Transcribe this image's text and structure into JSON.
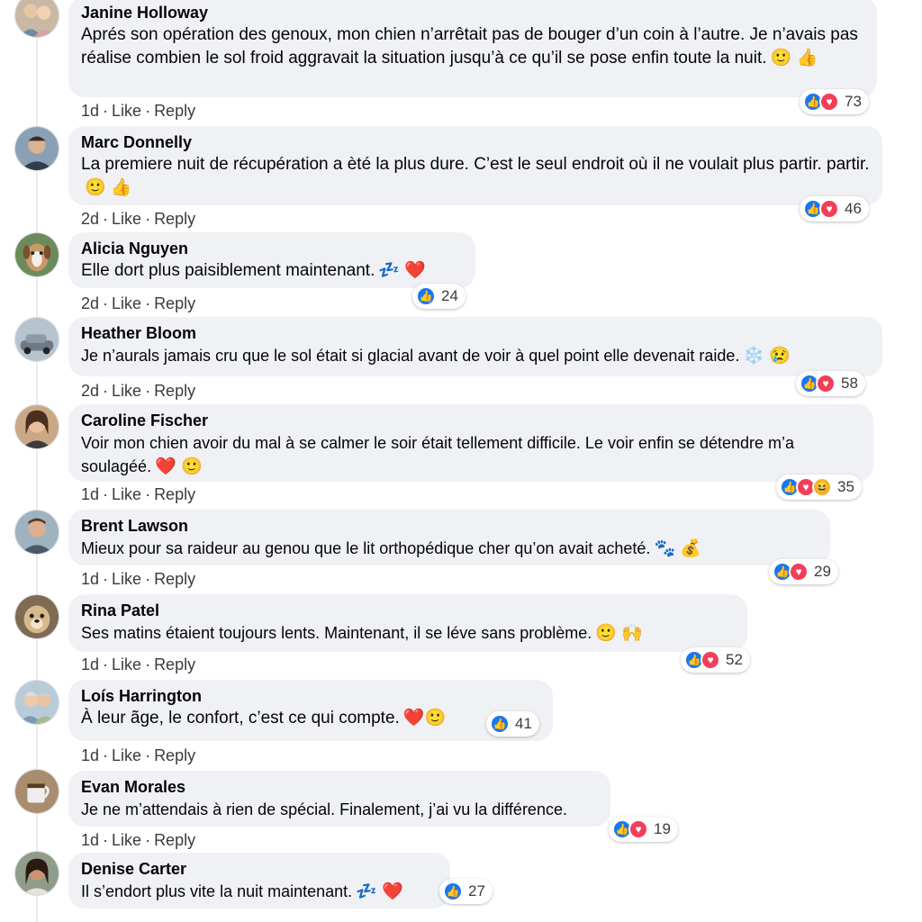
{
  "comments": [
    {
      "author": "Janine Holloway",
      "text": "Aprés son opération des genoux, mon chien n’arrêtait pas de bouger d’un coin à l’autre. Je n’avais pas réalise combien le sol froid aggravait la situation jusqu’à ce qu’il se pose enfin toute la nuit.",
      "emojis": "🙂 👍",
      "time": "1d",
      "like": "Like",
      "reply": "Reply",
      "reactions": [
        "like",
        "love"
      ],
      "count": "73"
    },
    {
      "author": "Marc Donnelly",
      "text": "La premiere nuit de récupération a èté la plus dure. C’est le seul endroit où il ne voulait plus partir. partir.",
      "emojis": "🙂 👍",
      "time": "2d",
      "like": "Like",
      "reply": "Reply",
      "reactions": [
        "like",
        "love"
      ],
      "count": "46"
    },
    {
      "author": "Alicia Nguyen",
      "text": "Elle dort plus paisiblement maintenant.",
      "emojis": "💤 ❤️",
      "time": "2d",
      "like": "Like",
      "reply": "Reply",
      "reactions": [
        "like"
      ],
      "count": "24"
    },
    {
      "author": "Heather Bloom",
      "text": "Je n’aurals jamais cru que le sol était si glacial avant de voir à quel point elle devenait raide.",
      "emojis": "❄️ 😢",
      "time": "2d",
      "like": "Like",
      "reply": "Reply",
      "reactions": [
        "like",
        "love"
      ],
      "count": "58"
    },
    {
      "author": "Caroline Fischer",
      "text": "Voir mon chien avoir du mal à se calmer le soir était tellement difficile. Le voir enfin se détendre m’a soulagéé.",
      "emojis": "❤️ 🙂",
      "time": "1d",
      "like": "Like",
      "reply": "Reply",
      "reactions": [
        "like",
        "love",
        "haha"
      ],
      "count": "35"
    },
    {
      "author": "Brent Lawson",
      "text": "Mieux pour sa raideur au genou que le lit orthopédique cher qu’on avait acheté.",
      "emojis": "🐾 💰",
      "time": "1d",
      "like": "Like",
      "reply": "Reply",
      "reactions": [
        "like",
        "love"
      ],
      "count": "29"
    },
    {
      "author": "Rina Patel",
      "text": "Ses matins étaient toujours lents. Maintenant, il se léve sans problème.",
      "emojis": "🙂 🙌",
      "time": "1d",
      "like": "Like",
      "reply": "Reply",
      "reactions": [
        "like",
        "love"
      ],
      "count": "52"
    },
    {
      "author": "Loís Harrington",
      "text": "À leur ãge, le confort, c’est ce qui compte.",
      "emojis": "❤️🙂",
      "time": "1d",
      "like": "Like",
      "reply": "Reply",
      "reactions": [
        "like"
      ],
      "count": "41"
    },
    {
      "author": "Evan Morales",
      "text": "Je ne m’attendais à rien de spécial. Finalement, j’ai vu la différence.",
      "emojis": "",
      "time": "1d",
      "like": "Like",
      "reply": "Reply",
      "reactions": [
        "like",
        "love"
      ],
      "count": "19"
    },
    {
      "author": "Denise Carter",
      "text": "Il s’endort plus vite la nuit maintenant.",
      "emojis": "💤 ❤️",
      "time": "",
      "like": "",
      "reply": "",
      "reactions": [
        "like"
      ],
      "count": "27"
    }
  ],
  "colors": {
    "like": "#1877f2",
    "love": "#f33e58",
    "haha": "#f7b125",
    "bubble": "#eff1f4"
  },
  "icons": {
    "like": "thumbs-up-icon",
    "love": "heart-icon",
    "haha": "laughing-face-icon"
  }
}
